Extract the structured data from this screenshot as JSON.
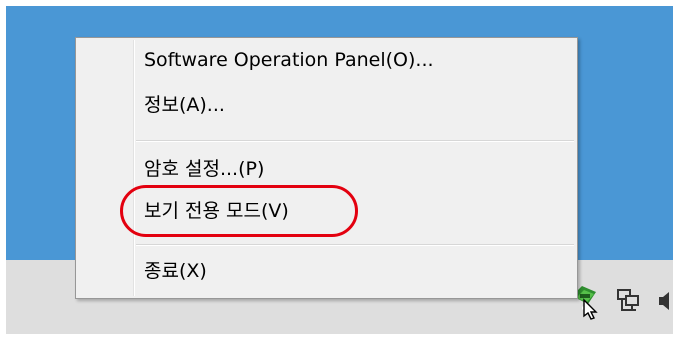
{
  "desktop": {
    "background_color": "#4a97d5"
  },
  "taskbar": {
    "background_color": "#dedede",
    "tray_icons": [
      "show-hidden-icons-arrow",
      "scanner-tray-icon",
      "network-icon",
      "volume-icon"
    ]
  },
  "context_menu": {
    "items": [
      {
        "label": "Software Operation Panel(O)..."
      },
      {
        "label": "정보(A)..."
      },
      {
        "label": "암호 설정...(P)"
      },
      {
        "label": "보기 전용 모드(V)"
      },
      {
        "label": "종료(X)"
      }
    ],
    "highlight_color": "#e3000f"
  }
}
